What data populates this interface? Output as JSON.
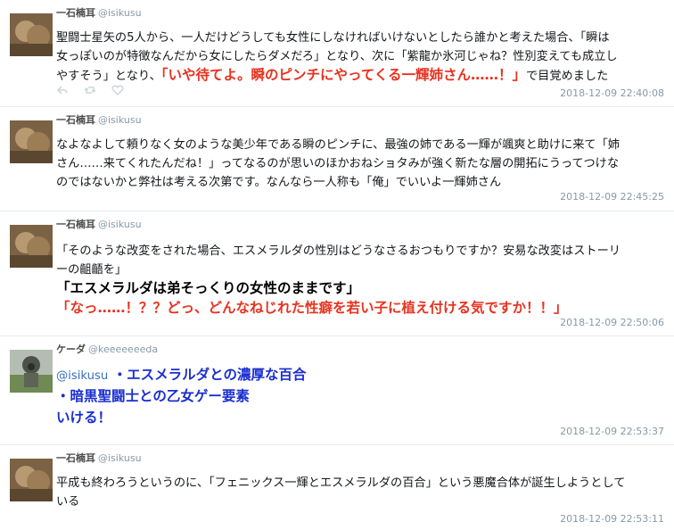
{
  "tweets": [
    {
      "name": "一石楠耳",
      "handle": "@isikusu",
      "lines": [
        [
          {
            "t": "聖闘士星矢の5人から、一人だけどうしても女性にしなければいけないとしたら誰かと考えた場合、「瞬は"
          }
        ],
        [
          {
            "t": "女っぽいのが特徴なんだから女にしたらダメだろ」となり、次に「紫龍か氷河じゃね？性別変えても成立し"
          }
        ],
        [
          {
            "t": "やすそう」となり、"
          },
          {
            "t": "「いや待てよ。瞬のピンチにやってくる一輝姉さん……！」",
            "style": "red"
          },
          {
            "t": "で目覚めました"
          }
        ]
      ],
      "timestamp": "2018-12-09 22:40:08"
    },
    {
      "name": "一石楠耳",
      "handle": "@isikusu",
      "lines": [
        [
          {
            "t": "なよなよして頼りなく女のような美少年である瞬のピンチに、最強の姉である一輝が颯爽と助けに来て「姉"
          }
        ],
        [
          {
            "t": "さん……来てくれたんだね！」ってなるのが思いのほかおねショタみが強く新たな層の開拓にうってつけな"
          }
        ],
        [
          {
            "t": "のではないかと弊社は考える次第です。なんなら一人称も「俺」でいいよ一輝姉さん"
          }
        ]
      ],
      "timestamp": "2018-12-09 22:45:25"
    },
    {
      "name": "一石楠耳",
      "handle": "@isikusu",
      "lines": [
        [
          {
            "t": "「そのような改変をされた場合、エスメラルダの性別はどうなさるおつもりですか？安易な改変はストーリ"
          }
        ],
        [
          {
            "t": "ーの齟齬を」"
          }
        ],
        [
          {
            "t": "「エスメラルダは弟そっくりの女性のままです」",
            "style": "black-big"
          }
        ],
        [
          {
            "t": "「なっ……！？？どっ、どんなねじれた性癖を若い子に植え付ける気ですか！！」",
            "style": "red"
          }
        ]
      ],
      "timestamp": "2018-12-09 22:50:06"
    },
    {
      "name": "ケーダ",
      "handle": "@keeeeeeeda",
      "lines": [
        [
          {
            "t": "@isikusu",
            "style": "mention"
          },
          {
            "t": " ・エスメラルダとの濃厚な百合",
            "style": "blue-big"
          }
        ],
        [
          {
            "t": "・暗黒聖闘士との乙女ゲー要素",
            "style": "blue-big"
          }
        ],
        [
          {
            "t": "いける！",
            "style": "blue-big"
          }
        ]
      ],
      "timestamp": "2018-12-09 22:53:37"
    },
    {
      "name": "一石楠耳",
      "handle": "@isikusu",
      "lines": [
        [
          {
            "t": "平成も終わろうというのに、「フェニックス一輝とエスメラルダの百合」という悪魔合体が誕生しようとして"
          }
        ],
        [
          {
            "t": "いる"
          }
        ]
      ],
      "timestamp": "2018-12-09 22:53:11"
    }
  ],
  "icons": [
    "reply-icon",
    "retweet-icon",
    "like-icon"
  ]
}
